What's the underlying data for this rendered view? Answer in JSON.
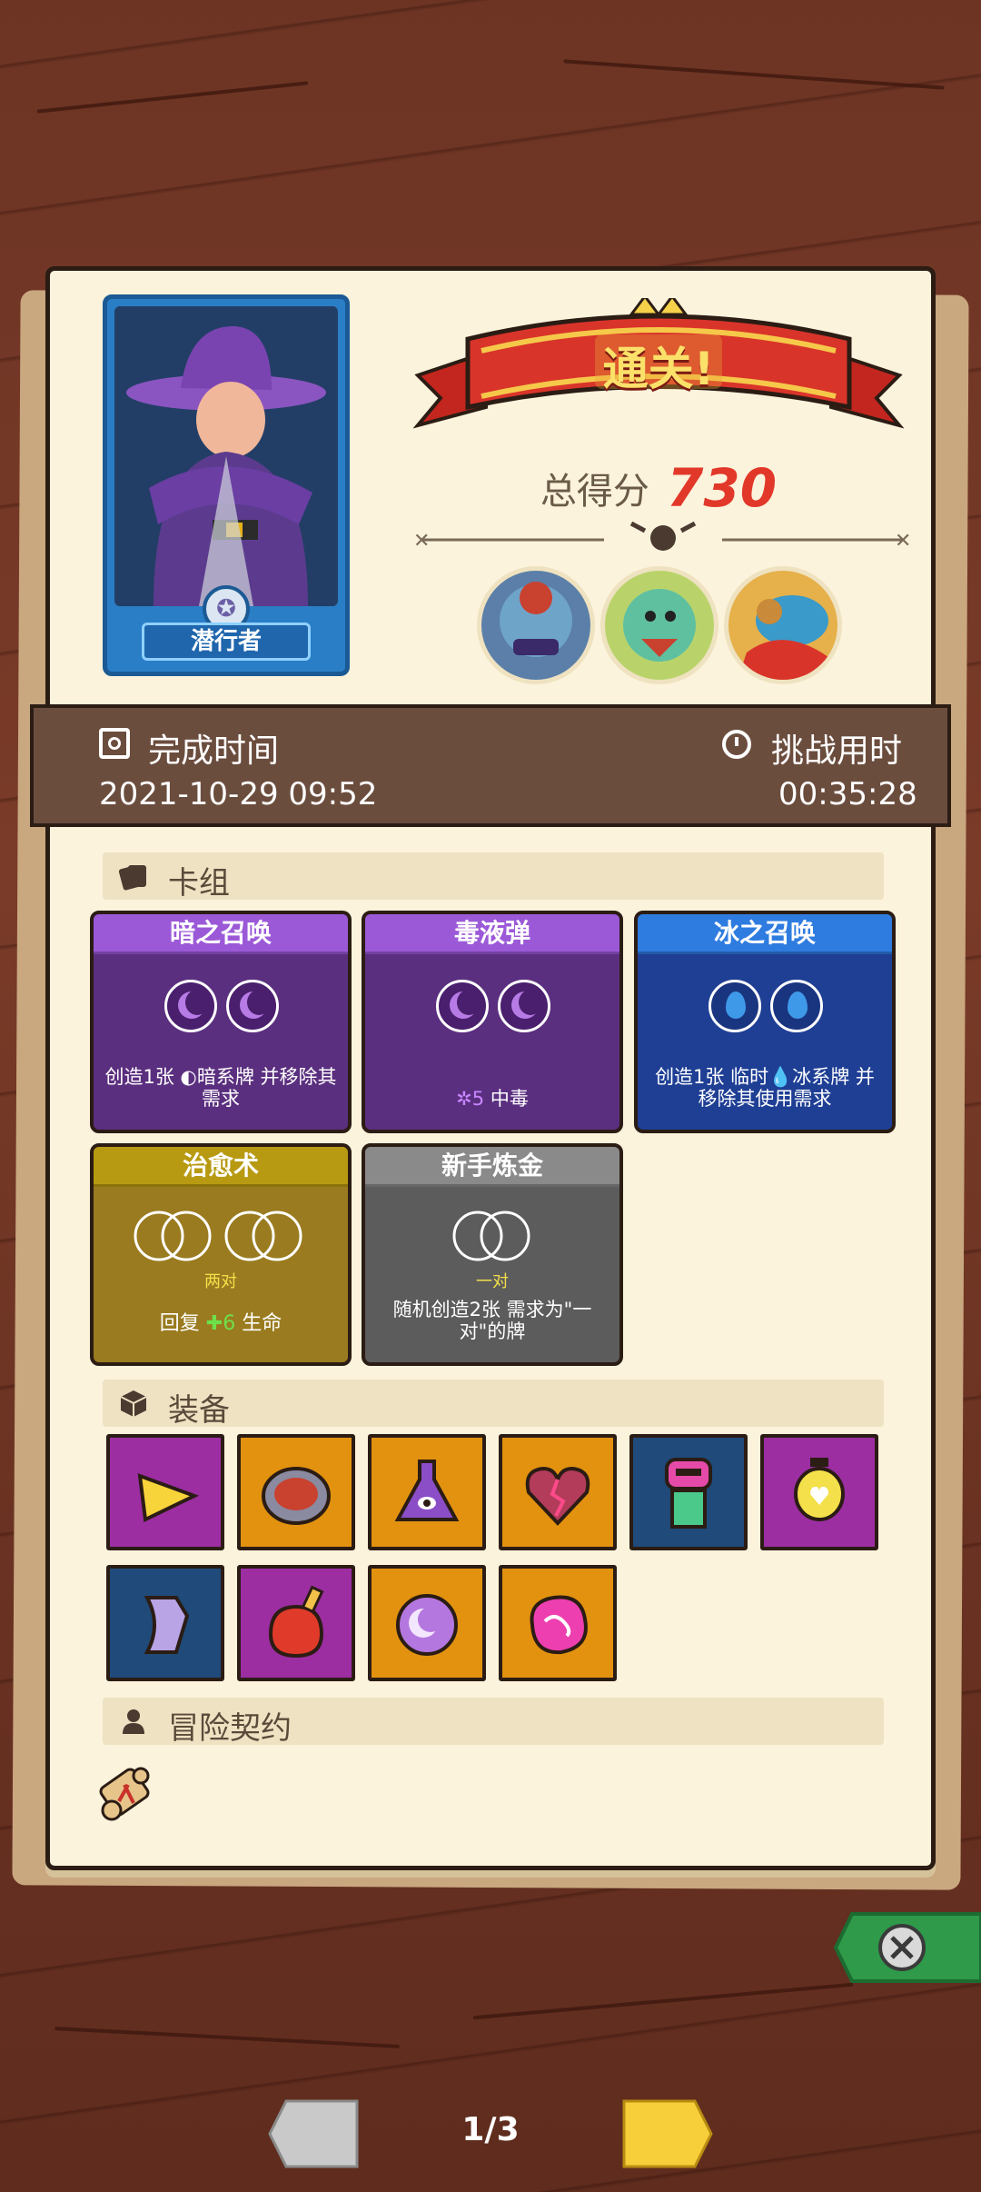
{
  "portrait": {
    "class_name": "潜行者"
  },
  "result": {
    "banner_text": "通关!",
    "score_label": "总得分",
    "score_value": "730"
  },
  "time": {
    "complete_label": "完成时间",
    "complete_value": "2021-10-29 09:52",
    "duration_label": "挑战用时",
    "duration_value": "00:35:28"
  },
  "deck": {
    "title": "卡组",
    "cards": [
      {
        "name": "暗之召唤",
        "cost": "dark-dark",
        "desc": "创造1张 ◐暗系牌 并移除其需求",
        "color": "#5b2f7f"
      },
      {
        "name": "毒液弹",
        "cost": "dark-dark",
        "desc_icon": "✲5",
        "desc": "中毒",
        "color": "#5b2f7f"
      },
      {
        "name": "冰之召唤",
        "cost": "water-water",
        "desc": "创造1张 临时💧冰系牌 并移除其使用需求",
        "color": "#1f3f95"
      },
      {
        "name": "治愈术",
        "cost": "two-pairs",
        "pair_label": "两对",
        "desc_pre": "回复",
        "desc_icon": "✚6",
        "desc": "生命",
        "color": "#9a7b1f"
      },
      {
        "name": "新手炼金",
        "cost": "one-pair",
        "pair_label": "一对",
        "desc": "随机创造2张 需求为\"一对\"的牌",
        "color": "#5c5c5c"
      }
    ]
  },
  "equipment": {
    "title": "装备",
    "items": [
      {
        "icon": "cheese-wedge-icon",
        "bg": "#9c2ea2"
      },
      {
        "icon": "bronze-shield-icon",
        "bg": "#e2920f"
      },
      {
        "icon": "eye-flask-icon",
        "bg": "#e2920f"
      },
      {
        "icon": "cracked-heart-icon",
        "bg": "#e2920f"
      },
      {
        "icon": "pink-totem-icon",
        "bg": "#1f4a7a"
      },
      {
        "icon": "heart-lantern-icon",
        "bg": "#9c2ea2"
      },
      {
        "icon": "crescent-armor-icon",
        "bg": "#1f4a7a"
      },
      {
        "icon": "red-dragon-bottle-icon",
        "bg": "#9c2ea2"
      },
      {
        "icon": "moon-orb-icon",
        "bg": "#e2920f"
      },
      {
        "icon": "pink-blob-icon",
        "bg": "#e2920f"
      }
    ]
  },
  "contract": {
    "title": "冒险契约"
  },
  "pager": {
    "current": "1/3"
  }
}
